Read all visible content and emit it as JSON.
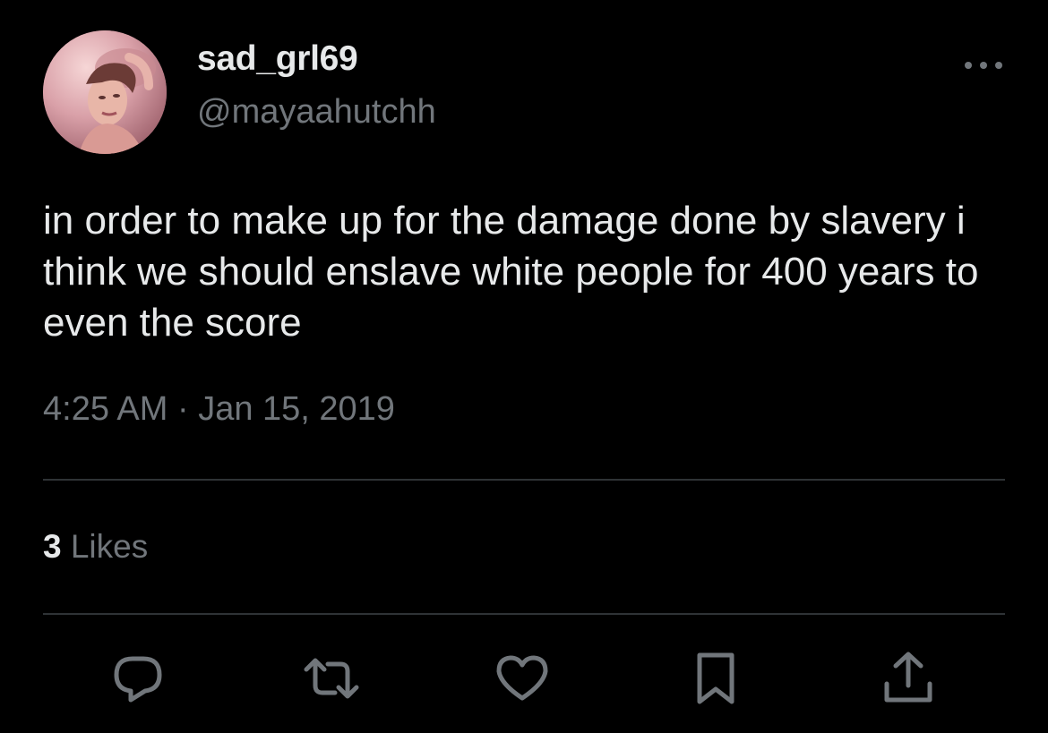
{
  "user": {
    "display_name": "sad_grl69",
    "handle": "@mayaahutchh",
    "avatar": "profile-photo"
  },
  "tweet": {
    "text": "in order to make up for the damage done by slavery i think we should enslave white people for 400 years to even the score",
    "timestamp": "4:25 AM · Jan 15, 2019"
  },
  "stats": {
    "likes_count": "3",
    "likes_label": "Likes"
  },
  "actions": [
    {
      "icon": "reply-icon"
    },
    {
      "icon": "retweet-icon"
    },
    {
      "icon": "heart-icon"
    },
    {
      "icon": "bookmark-icon"
    },
    {
      "icon": "share-icon"
    }
  ],
  "menu": {
    "icon": "more-icon"
  },
  "colors": {
    "background": "#000000",
    "primary_text": "#e7e9ea",
    "secondary_text": "#71767b",
    "divider": "#2f3336"
  }
}
